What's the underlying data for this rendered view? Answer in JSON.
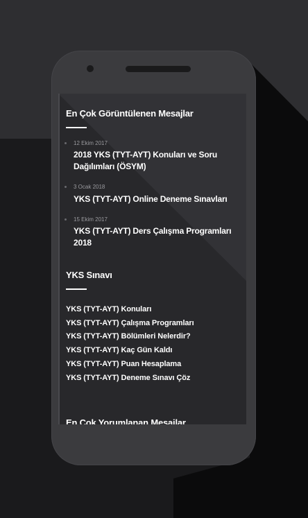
{
  "sections": {
    "most_viewed": {
      "title": "En Çok Görüntülenen Mesajlar",
      "posts": [
        {
          "date": "12 Ekim 2017",
          "title": "2018 YKS (TYT-AYT) Konuları ve Soru Dağılımları (ÖSYM)"
        },
        {
          "date": "3 Ocak 2018",
          "title": "YKS (TYT-AYT) Online Deneme Sınavları"
        },
        {
          "date": "15 Ekim 2017",
          "title": "YKS (TYT-AYT) Ders Çalışma Programları 2018"
        }
      ]
    },
    "yks": {
      "title": "YKS Sınavı",
      "links": [
        "YKS (TYT-AYT) Konuları",
        "YKS (TYT-AYT) Çalışma Programları",
        "YKS (TYT-AYT) Bölümleri Nelerdir?",
        "YKS (TYT-AYT) Kaç Gün Kaldı",
        "YKS (TYT-AYT) Puan Hesaplama",
        "YKS (TYT-AYT) Deneme Sınavı Çöz"
      ]
    },
    "most_commented": {
      "title": "En Çok Yorumlanan Mesajlar"
    }
  }
}
